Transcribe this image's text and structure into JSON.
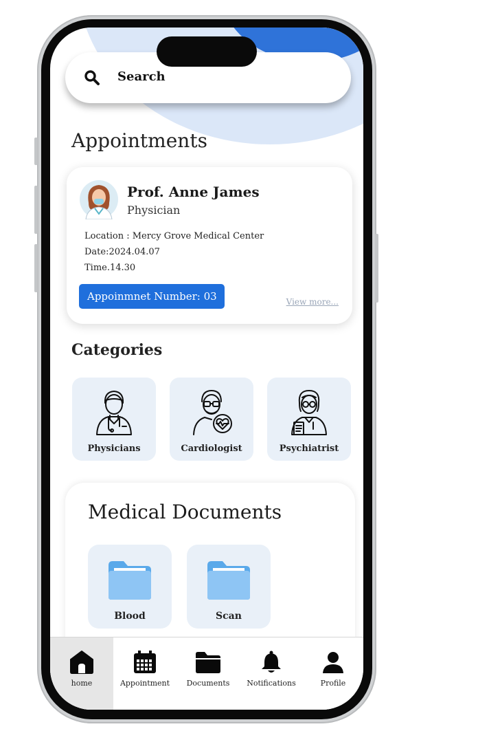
{
  "search": {
    "placeholder": "Search"
  },
  "appointments": {
    "title": "Appointments",
    "card": {
      "doctor_name": "Prof. Anne James",
      "doctor_role": "Physician",
      "location": "Location : Mercy Grove Medical Center",
      "date": "Date:2024.04.07",
      "time": "Time.14.30",
      "badge": "Appoinmnet Number: 03",
      "view_more": "View more..."
    }
  },
  "categories": {
    "title": "Categories",
    "items": [
      {
        "label": "Physicians",
        "icon": "doctor-icon"
      },
      {
        "label": "Cardiologist",
        "icon": "cardiologist-icon"
      },
      {
        "label": "Psychiatrist",
        "icon": "psychiatrist-icon"
      }
    ]
  },
  "medical_documents": {
    "title": "Medical Documents",
    "items": [
      {
        "label": "Blood",
        "icon": "folder-icon"
      },
      {
        "label": "Scan",
        "icon": "folder-icon"
      }
    ]
  },
  "nav": {
    "items": [
      {
        "label": "home",
        "icon": "home-icon",
        "active": true
      },
      {
        "label": "Appointment",
        "icon": "calendar-icon"
      },
      {
        "label": "Documents",
        "icon": "folder-icon"
      },
      {
        "label": "Notifications",
        "icon": "bell-icon"
      },
      {
        "label": "Profile",
        "icon": "user-icon"
      }
    ]
  },
  "colors": {
    "accent": "#1f6fdc",
    "header_blob_light": "#dbe7f8",
    "header_blob_dark": "#2f73d9",
    "tile_bg": "#e9f0f8",
    "folder": "#8ec5f4"
  }
}
